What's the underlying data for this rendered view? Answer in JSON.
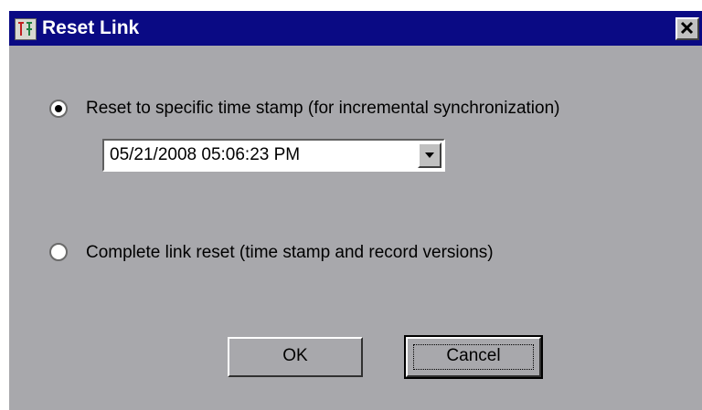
{
  "window": {
    "title": "Reset Link",
    "icons": {
      "app": "app-icon",
      "close": "close-icon"
    }
  },
  "options": [
    {
      "label": "Reset to specific time stamp (for incremental synchronization)",
      "selected": true
    },
    {
      "label": "Complete link reset (time stamp and record versions)",
      "selected": false
    }
  ],
  "timestamp": {
    "value": "05/21/2008 05:06:23  PM",
    "dropdown_icon": "chevron-down-icon"
  },
  "buttons": {
    "ok": "OK",
    "cancel": "Cancel"
  }
}
